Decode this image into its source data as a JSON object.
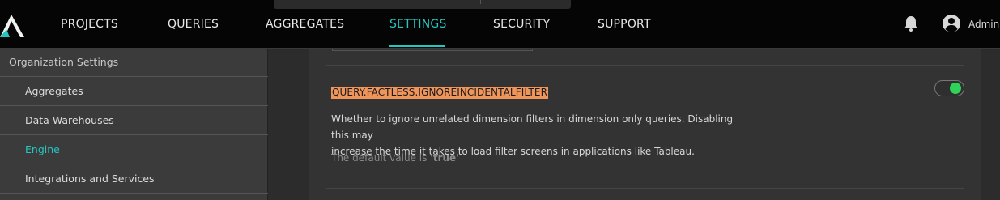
{
  "nav": {
    "items": [
      "PROJECTS",
      "QUERIES",
      "AGGREGATES",
      "SETTINGS",
      "SECURITY",
      "SUPPORT"
    ],
    "active": "SETTINGS",
    "user_name": "Admin"
  },
  "sidebar": {
    "header": "Organization Settings",
    "items": [
      {
        "label": "Aggregates"
      },
      {
        "label": "Data Warehouses"
      },
      {
        "label": "Engine"
      },
      {
        "label": "Integrations and Services"
      }
    ],
    "active": "Engine"
  },
  "setting": {
    "key": "QUERY.FACTLESS.IGNOREINCIDENTALFILTER",
    "description_line1": "Whether to ignore unrelated dimension filters in dimension only queries. Disabling this may",
    "description_line2": "increase the time it takes to load filter screens in applications like Tableau.",
    "default_prefix": "The default value is ",
    "default_value": "'true'",
    "enabled": true
  },
  "colors": {
    "accent": "#25c6c2",
    "highlight": "#f0955a",
    "toggle_on": "#2fd35a"
  }
}
